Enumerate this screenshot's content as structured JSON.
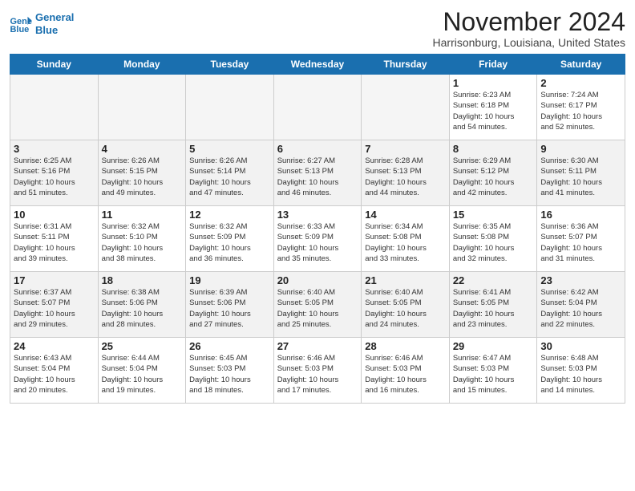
{
  "header": {
    "logo_line1": "General",
    "logo_line2": "Blue",
    "month_title": "November 2024",
    "subtitle": "Harrisonburg, Louisiana, United States"
  },
  "days_of_week": [
    "Sunday",
    "Monday",
    "Tuesday",
    "Wednesday",
    "Thursday",
    "Friday",
    "Saturday"
  ],
  "weeks": [
    [
      {
        "day": "",
        "empty": true
      },
      {
        "day": "",
        "empty": true
      },
      {
        "day": "",
        "empty": true
      },
      {
        "day": "",
        "empty": true
      },
      {
        "day": "",
        "empty": true
      },
      {
        "day": "1",
        "sunrise": "6:23 AM",
        "sunset": "6:18 PM",
        "daylight": "10 hours and 54 minutes."
      },
      {
        "day": "2",
        "sunrise": "7:24 AM",
        "sunset": "6:17 PM",
        "daylight": "10 hours and 52 minutes."
      }
    ],
    [
      {
        "day": "3",
        "sunrise": "6:25 AM",
        "sunset": "5:16 PM",
        "daylight": "10 hours and 51 minutes."
      },
      {
        "day": "4",
        "sunrise": "6:26 AM",
        "sunset": "5:15 PM",
        "daylight": "10 hours and 49 minutes."
      },
      {
        "day": "5",
        "sunrise": "6:26 AM",
        "sunset": "5:14 PM",
        "daylight": "10 hours and 47 minutes."
      },
      {
        "day": "6",
        "sunrise": "6:27 AM",
        "sunset": "5:13 PM",
        "daylight": "10 hours and 46 minutes."
      },
      {
        "day": "7",
        "sunrise": "6:28 AM",
        "sunset": "5:13 PM",
        "daylight": "10 hours and 44 minutes."
      },
      {
        "day": "8",
        "sunrise": "6:29 AM",
        "sunset": "5:12 PM",
        "daylight": "10 hours and 42 minutes."
      },
      {
        "day": "9",
        "sunrise": "6:30 AM",
        "sunset": "5:11 PM",
        "daylight": "10 hours and 41 minutes."
      }
    ],
    [
      {
        "day": "10",
        "sunrise": "6:31 AM",
        "sunset": "5:11 PM",
        "daylight": "10 hours and 39 minutes."
      },
      {
        "day": "11",
        "sunrise": "6:32 AM",
        "sunset": "5:10 PM",
        "daylight": "10 hours and 38 minutes."
      },
      {
        "day": "12",
        "sunrise": "6:32 AM",
        "sunset": "5:09 PM",
        "daylight": "10 hours and 36 minutes."
      },
      {
        "day": "13",
        "sunrise": "6:33 AM",
        "sunset": "5:09 PM",
        "daylight": "10 hours and 35 minutes."
      },
      {
        "day": "14",
        "sunrise": "6:34 AM",
        "sunset": "5:08 PM",
        "daylight": "10 hours and 33 minutes."
      },
      {
        "day": "15",
        "sunrise": "6:35 AM",
        "sunset": "5:08 PM",
        "daylight": "10 hours and 32 minutes."
      },
      {
        "day": "16",
        "sunrise": "6:36 AM",
        "sunset": "5:07 PM",
        "daylight": "10 hours and 31 minutes."
      }
    ],
    [
      {
        "day": "17",
        "sunrise": "6:37 AM",
        "sunset": "5:07 PM",
        "daylight": "10 hours and 29 minutes."
      },
      {
        "day": "18",
        "sunrise": "6:38 AM",
        "sunset": "5:06 PM",
        "daylight": "10 hours and 28 minutes."
      },
      {
        "day": "19",
        "sunrise": "6:39 AM",
        "sunset": "5:06 PM",
        "daylight": "10 hours and 27 minutes."
      },
      {
        "day": "20",
        "sunrise": "6:40 AM",
        "sunset": "5:05 PM",
        "daylight": "10 hours and 25 minutes."
      },
      {
        "day": "21",
        "sunrise": "6:40 AM",
        "sunset": "5:05 PM",
        "daylight": "10 hours and 24 minutes."
      },
      {
        "day": "22",
        "sunrise": "6:41 AM",
        "sunset": "5:05 PM",
        "daylight": "10 hours and 23 minutes."
      },
      {
        "day": "23",
        "sunrise": "6:42 AM",
        "sunset": "5:04 PM",
        "daylight": "10 hours and 22 minutes."
      }
    ],
    [
      {
        "day": "24",
        "sunrise": "6:43 AM",
        "sunset": "5:04 PM",
        "daylight": "10 hours and 20 minutes."
      },
      {
        "day": "25",
        "sunrise": "6:44 AM",
        "sunset": "5:04 PM",
        "daylight": "10 hours and 19 minutes."
      },
      {
        "day": "26",
        "sunrise": "6:45 AM",
        "sunset": "5:03 PM",
        "daylight": "10 hours and 18 minutes."
      },
      {
        "day": "27",
        "sunrise": "6:46 AM",
        "sunset": "5:03 PM",
        "daylight": "10 hours and 17 minutes."
      },
      {
        "day": "28",
        "sunrise": "6:46 AM",
        "sunset": "5:03 PM",
        "daylight": "10 hours and 16 minutes."
      },
      {
        "day": "29",
        "sunrise": "6:47 AM",
        "sunset": "5:03 PM",
        "daylight": "10 hours and 15 minutes."
      },
      {
        "day": "30",
        "sunrise": "6:48 AM",
        "sunset": "5:03 PM",
        "daylight": "10 hours and 14 minutes."
      }
    ]
  ],
  "labels": {
    "sunrise": "Sunrise:",
    "sunset": "Sunset:",
    "daylight": "Daylight:"
  }
}
